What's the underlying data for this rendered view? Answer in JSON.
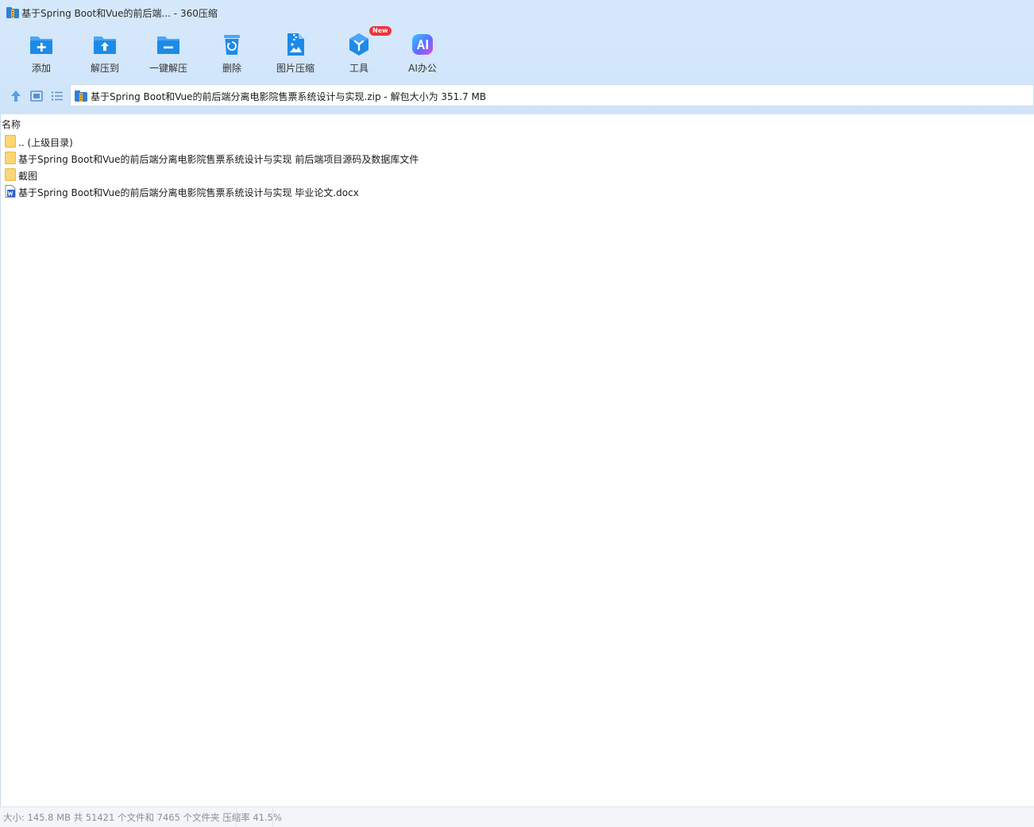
{
  "window": {
    "title": "基于Spring Boot和Vue的前后端... - 360压缩"
  },
  "toolbar": {
    "items": [
      {
        "label": "添加",
        "icon": "folder-add-icon"
      },
      {
        "label": "解压到",
        "icon": "folder-extract-icon"
      },
      {
        "label": "一键解压",
        "icon": "folder-oneclick-icon"
      },
      {
        "label": "删除",
        "icon": "recycle-bin-icon"
      },
      {
        "label": "图片压缩",
        "icon": "image-compress-icon"
      },
      {
        "label": "工具",
        "icon": "tools-cube-icon",
        "badge": "New"
      },
      {
        "label": "AI办公",
        "icon": "ai-office-icon"
      }
    ]
  },
  "address": {
    "path": "基于Spring Boot和Vue的前后端分离电影院售票系统设计与实现.zip - 解包大小为 351.7 MB"
  },
  "filelist": {
    "column_name": "名称",
    "rows": [
      {
        "name": ".. (上级目录)",
        "type": "folder"
      },
      {
        "name": "基于Spring Boot和Vue的前后端分离电影院售票系统设计与实现 前后端项目源码及数据库文件",
        "type": "folder"
      },
      {
        "name": "截图",
        "type": "folder"
      },
      {
        "name": "基于Spring Boot和Vue的前后端分离电影院售票系统设计与实现 毕业论文.docx",
        "type": "word-document"
      }
    ]
  },
  "status": {
    "text": "大小: 145.8 MB 共 51421 个文件和 7465 个文件夹 压缩率 41.5%"
  },
  "colors": {
    "accent": "#1e8ae8",
    "toolbar_bg": "#d4e7fb",
    "badge": "#f0323c"
  }
}
